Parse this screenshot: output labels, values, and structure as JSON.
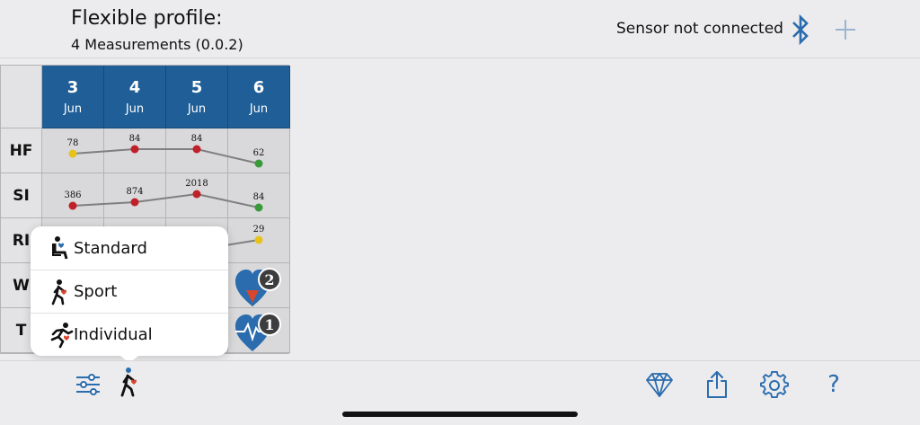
{
  "header": {
    "title": "Flexible profile:",
    "subtitle": "4 Measurements (0.0.2)",
    "sensor_status": "Sensor not connected"
  },
  "grid": {
    "dates": [
      {
        "day": "3",
        "month": "Jun"
      },
      {
        "day": "4",
        "month": "Jun"
      },
      {
        "day": "5",
        "month": "Jun"
      },
      {
        "day": "6",
        "month": "Jun"
      }
    ],
    "rows": [
      {
        "label": "HF",
        "values": [
          "78",
          "84",
          "84",
          "62"
        ],
        "status": [
          "yellow",
          "red",
          "red",
          "green"
        ]
      },
      {
        "label": "SI",
        "values": [
          "386",
          "874",
          "2018",
          "84"
        ],
        "status": [
          "red",
          "red",
          "red",
          "green"
        ]
      },
      {
        "label": "RI",
        "visible_value": "29",
        "visible_status": "yellow"
      },
      {
        "label": "W",
        "badge": "2"
      },
      {
        "label": "T",
        "badge": "1"
      }
    ],
    "colors": {
      "header": "#1f5e96",
      "red": "#c0202a",
      "green": "#3a9a3a",
      "yellow": "#e6c21a",
      "line": "#7f7f7f"
    }
  },
  "popup": {
    "items": [
      {
        "label": "Standard",
        "icon": "seated-person-icon"
      },
      {
        "label": "Sport",
        "icon": "walking-person-icon"
      },
      {
        "label": "Individual",
        "icon": "running-person-icon"
      }
    ]
  },
  "toolbar": {
    "icons": [
      "sliders-icon",
      "walking-person-icon",
      "diamond-icon",
      "share-icon",
      "gear-icon",
      "help-icon"
    ],
    "help_label": "?"
  },
  "accent_color": "#2a6cad"
}
